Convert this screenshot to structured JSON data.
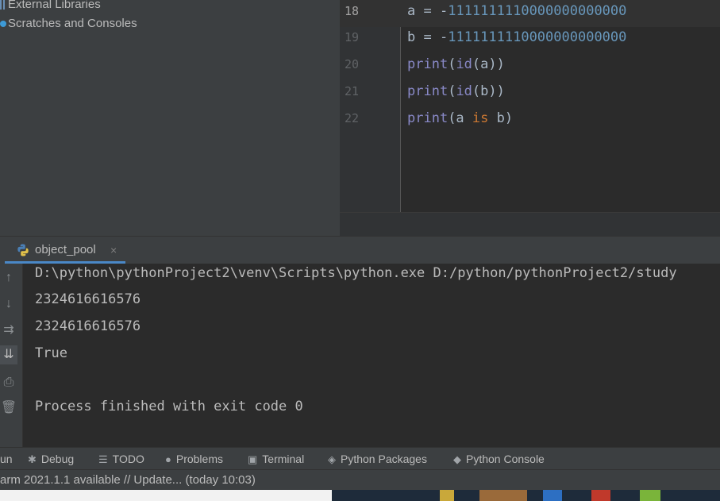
{
  "project_tree": {
    "items": [
      {
        "label": "External Libraries",
        "icon": "library-icon"
      },
      {
        "label": "Scratches and Consoles",
        "icon": "scratch-icon"
      }
    ]
  },
  "editor": {
    "lines": [
      {
        "number": "18",
        "var": "a",
        "op": " = ",
        "neg": "-",
        "value": "1111111110000000000000"
      },
      {
        "number": "19",
        "var": "b",
        "op": " = ",
        "neg": "-",
        "value": "1111111110000000000000"
      },
      {
        "number": "20",
        "fn": "print",
        "open": "(",
        "inner_fn": "id",
        "inner": "(a))"
      },
      {
        "number": "21",
        "fn": "print",
        "open": "(",
        "inner_fn": "id",
        "inner": "(b))"
      },
      {
        "number": "22",
        "fn": "print",
        "open": "(a ",
        "kw": "is",
        "close": " b)"
      }
    ]
  },
  "run_panel": {
    "tab_label": "object_pool",
    "tab_close": "×",
    "output": [
      "D:\\python\\pythonProject2\\venv\\Scripts\\python.exe D:/python/pythonProject2/study",
      "2324616616576",
      "2324616616576",
      "True",
      "",
      "Process finished with exit code 0"
    ]
  },
  "tool_tabs": [
    {
      "label": "un",
      "icon": ""
    },
    {
      "label": "Debug",
      "icon": "bug-icon"
    },
    {
      "label": "TODO",
      "icon": "list-icon"
    },
    {
      "label": "Problems",
      "icon": "info-icon"
    },
    {
      "label": "Terminal",
      "icon": "terminal-icon"
    },
    {
      "label": "Python Packages",
      "icon": "layers-icon"
    },
    {
      "label": "Python Console",
      "icon": "python-icon"
    }
  ],
  "status_bar": {
    "text": "arm 2021.1.1 available // Update... (today 10:03)"
  },
  "colors": {
    "accent": "#4a88c7",
    "number": "#6897bb",
    "keyword": "#cc7832",
    "builtin": "#8888c6"
  }
}
